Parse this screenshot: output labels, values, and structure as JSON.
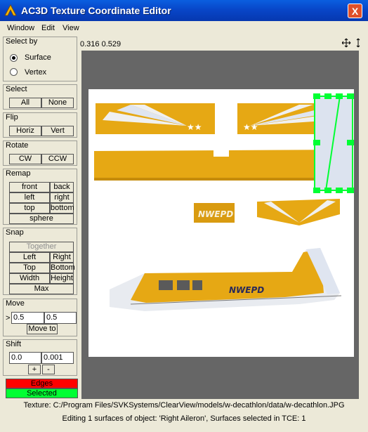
{
  "window": {
    "title": "AC3D Texture Coordinate Editor",
    "close_label": "X"
  },
  "menu": [
    "Window",
    "Edit",
    "View"
  ],
  "coords_readout": "0.316 0.529",
  "select_by": {
    "title": "Select by",
    "options": [
      "Surface",
      "Vertex"
    ],
    "selected": "Surface"
  },
  "select": {
    "title": "Select",
    "all": "All",
    "none": "None"
  },
  "flip": {
    "title": "Flip",
    "horiz": "Horiz",
    "vert": "Vert"
  },
  "rotate": {
    "title": "Rotate",
    "cw": "CW",
    "ccw": "CCW"
  },
  "remap": {
    "title": "Remap",
    "front": "front",
    "back": "back",
    "left": "left",
    "right": "right",
    "top": "top",
    "bottom": "bottom",
    "sphere": "sphere"
  },
  "snap": {
    "title": "Snap",
    "together": "Together",
    "left": "Left",
    "right": "Right",
    "top": "Top",
    "bottom": "Bottom",
    "width": "Width",
    "height": "Height",
    "max": "Max"
  },
  "move": {
    "title": "Move",
    "arrow": ">",
    "x": "0.5",
    "y": "0.5",
    "button": "Move to"
  },
  "shift": {
    "title": "Shift",
    "coarse": "0.0",
    "fine": "0.001",
    "plus": "+",
    "minus": "-"
  },
  "legend": {
    "edges": "Edges",
    "selected": "Selected",
    "edges_color": "#ff0000",
    "selected_color": "#00ff33"
  },
  "texture_labels": {
    "decal": "NWEPD",
    "fuselage_text": "NWEPD"
  },
  "status": {
    "texture": "Texture: C:/Program Files/SVKSystems/ClearView/models/w-decathlon/data/w-decathlon.JPG",
    "editing": "Editing 1 surfaces of object: 'Right Aileron', Surfaces selected in TCE: 1"
  }
}
